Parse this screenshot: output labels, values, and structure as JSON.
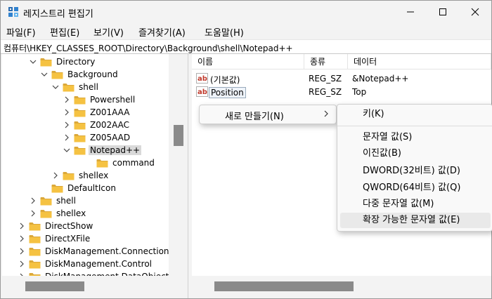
{
  "window": {
    "title": "레지스트리 편집기"
  },
  "menubar": {
    "items": [
      "파일(F)",
      "편집(E)",
      "보기(V)",
      "즐겨찾기(A)",
      "도움말(H)"
    ]
  },
  "address": {
    "path": "컴퓨터\\HKEY_CLASSES_ROOT\\Directory\\Background\\shell\\Notepad++"
  },
  "tree": {
    "items": [
      {
        "label": "Directory",
        "expanded": true
      },
      {
        "label": "Background",
        "expanded": true
      },
      {
        "label": "shell",
        "expanded": true
      },
      {
        "label": "Powershell",
        "expanded": false
      },
      {
        "label": "Z001AAA",
        "expanded": false
      },
      {
        "label": "Z002AAC",
        "expanded": false
      },
      {
        "label": "Z005AAD",
        "expanded": false
      },
      {
        "label": "Notepad++",
        "expanded": true,
        "selected": true
      },
      {
        "label": "command",
        "expanded": false
      },
      {
        "label": "shellex",
        "expanded": false
      },
      {
        "label": "DefaultIcon",
        "expanded": false
      },
      {
        "label": "shell",
        "expanded": false
      },
      {
        "label": "shellex",
        "expanded": false
      },
      {
        "label": "DirectShow",
        "expanded": false
      },
      {
        "label": "DirectXFile",
        "expanded": false
      },
      {
        "label": "DiskManagement.Connection",
        "expanded": false
      },
      {
        "label": "DiskManagement.Control",
        "expanded": false
      },
      {
        "label": "DiskManagement.DataObject",
        "expanded": false
      }
    ]
  },
  "list": {
    "headers": {
      "name": "이름",
      "type": "종류",
      "data": "데이터"
    },
    "rows": [
      {
        "name": "(기본값)",
        "type": "REG_SZ",
        "data": "&Notepad++"
      },
      {
        "name": "Position",
        "type": "REG_SZ",
        "data": "Top"
      }
    ]
  },
  "context_menu": {
    "new_label": "새로 만들기(N)",
    "arrow": "›"
  },
  "submenu": {
    "items": [
      "키(K)",
      "문자열 값(S)",
      "이진값(B)",
      "DWORD(32비트) 값(D)",
      "QWORD(64비트) 값(Q)",
      "다중 문자열 값(M)",
      "확장 가능한 문자열 값(E)"
    ]
  },
  "colors": {
    "folder": "#f5c242",
    "folder_dark": "#dba83a",
    "chrome": "#f3f3f3",
    "scroll_thumb": "#8a8a8a",
    "reg_icon_red": "#c0392b"
  }
}
